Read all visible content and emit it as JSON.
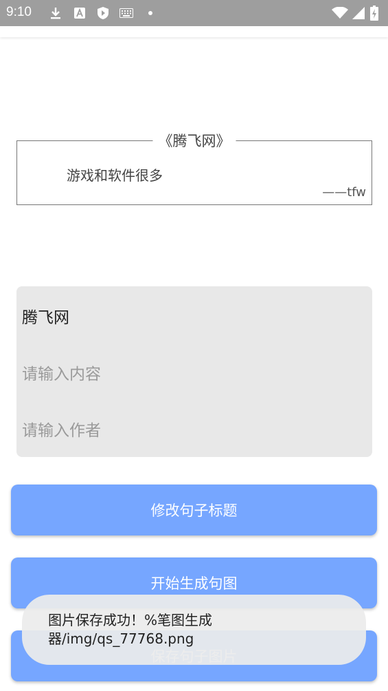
{
  "status_bar": {
    "time": "9:10",
    "icons_left": [
      "download-icon",
      "a-badge-icon",
      "play-protect-icon",
      "keyboard-icon",
      "dot-icon"
    ],
    "icons_right": [
      "wifi-icon",
      "signal-icon",
      "battery-icon"
    ]
  },
  "quote_card": {
    "title": "《腾飞网》",
    "content": "游戏和软件很多",
    "author": "——tfw"
  },
  "inputs": {
    "title_value": "腾飞网",
    "content_placeholder": "请输入内容",
    "author_placeholder": "请输入作者"
  },
  "buttons": {
    "edit_title": "修改句子标题",
    "generate": "开始生成句图",
    "save": "保存句子图片"
  },
  "toast": {
    "message": "图片保存成功！%笔图生成器/img/qs_77768.png"
  },
  "colors": {
    "status_bar": "#9e9e9e",
    "button": "#76a6ff",
    "input_panel": "#e8e8e8"
  }
}
